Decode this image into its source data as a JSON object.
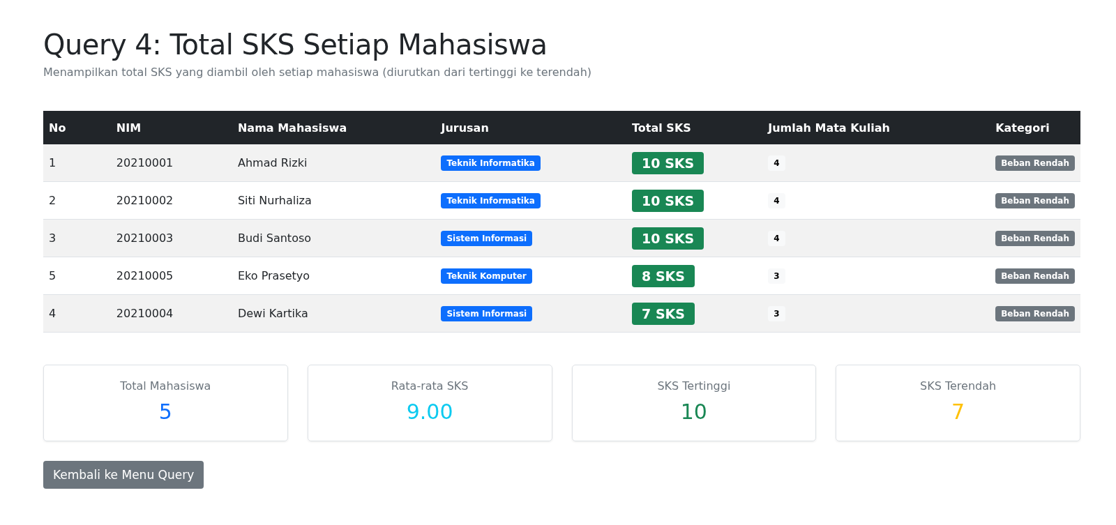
{
  "title": "Query 4: Total SKS Setiap Mahasiswa",
  "subtitle": "Menampilkan total SKS yang diambil oleh setiap mahasiswa (diurutkan dari tertinggi ke terendah)",
  "table": {
    "columns": [
      "No",
      "NIM",
      "Nama Mahasiswa",
      "Jurusan",
      "Total SKS",
      "Jumlah Mata Kuliah",
      "Kategori"
    ],
    "rows": [
      {
        "no": "1",
        "nim": "20210001",
        "nama": "Ahmad Rizki",
        "jurusan": "Teknik Informatika",
        "total_sks": "10 SKS",
        "jumlah": "4",
        "kategori": "Beban Rendah"
      },
      {
        "no": "2",
        "nim": "20210002",
        "nama": "Siti Nurhaliza",
        "jurusan": "Teknik Informatika",
        "total_sks": "10 SKS",
        "jumlah": "4",
        "kategori": "Beban Rendah"
      },
      {
        "no": "3",
        "nim": "20210003",
        "nama": "Budi Santoso",
        "jurusan": "Sistem Informasi",
        "total_sks": "10 SKS",
        "jumlah": "4",
        "kategori": "Beban Rendah"
      },
      {
        "no": "5",
        "nim": "20210005",
        "nama": "Eko Prasetyo",
        "jurusan": "Teknik Komputer",
        "total_sks": "8 SKS",
        "jumlah": "3",
        "kategori": "Beban Rendah"
      },
      {
        "no": "4",
        "nim": "20210004",
        "nama": "Dewi Kartika",
        "jurusan": "Sistem Informasi",
        "total_sks": "7 SKS",
        "jumlah": "3",
        "kategori": "Beban Rendah"
      }
    ]
  },
  "stats": [
    {
      "label": "Total Mahasiswa",
      "value": "5",
      "color": "#0d6efd"
    },
    {
      "label": "Rata-rata SKS",
      "value": "9.00",
      "color": "#0dcaf0"
    },
    {
      "label": "SKS Tertinggi",
      "value": "10",
      "color": "#198754"
    },
    {
      "label": "SKS Terendah",
      "value": "7",
      "color": "#ffc107"
    }
  ],
  "back_button": "Kembali ke Menu Query"
}
